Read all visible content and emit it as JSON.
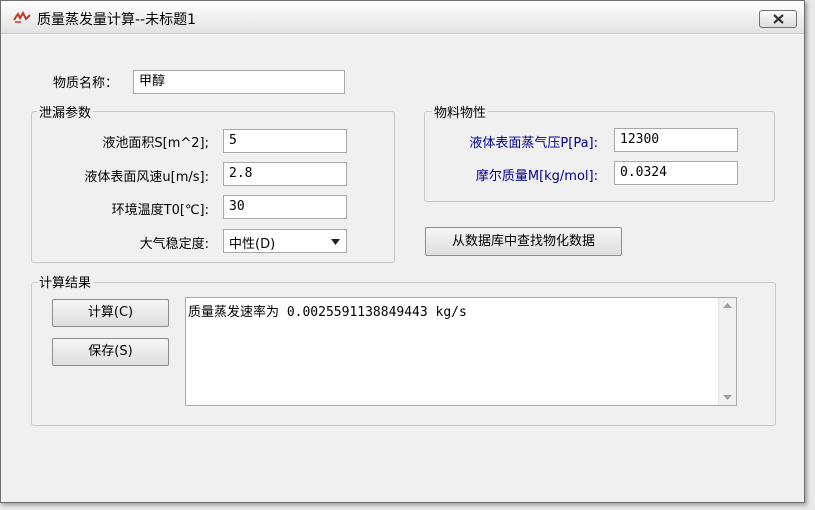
{
  "window": {
    "title": "质量蒸发量计算--未标题1"
  },
  "substance": {
    "label": "物质名称：",
    "value": "甲醇"
  },
  "leak_params": {
    "title": "泄漏参数",
    "fields": [
      {
        "label": "液池面积S[m^2];",
        "value": "5"
      },
      {
        "label": "液体表面风速u[m/s]:",
        "value": "2.8"
      },
      {
        "label": "环境温度T0[℃]:",
        "value": "30"
      }
    ],
    "stability": {
      "label": "大气稳定度:",
      "value": "中性(D)"
    }
  },
  "material_props": {
    "title": "物料物性",
    "fields": [
      {
        "label": "液体表面蒸气压P[Pa]:",
        "value": "12300"
      },
      {
        "label": "摩尔质量M[kg/mol]:",
        "value": "0.0324"
      }
    ],
    "lookup_button": "从数据库中查找物化数据"
  },
  "results": {
    "title": "计算结果",
    "calc_button": "计算(C)",
    "save_button": "保存(S)",
    "output": "质量蒸发速率为 0.0025591138849443 kg/s"
  },
  "colors": {
    "property_label": "#00008b"
  },
  "icons": {
    "app": "app-icon",
    "close": "close-icon",
    "dropdown": "chevron-down-icon"
  }
}
